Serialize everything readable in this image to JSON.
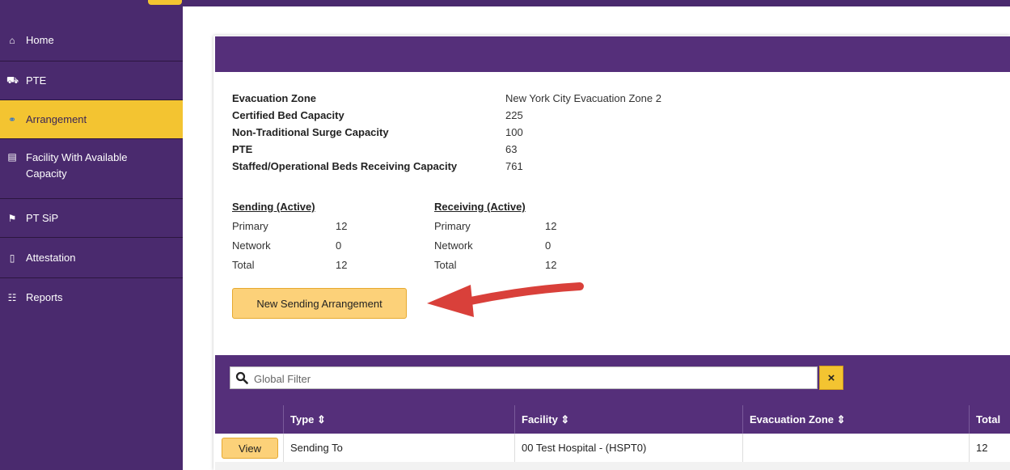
{
  "sidebar": {
    "items": [
      {
        "label": "Home",
        "icon": "home-icon"
      },
      {
        "label": "PTE",
        "icon": "vehicles-icon"
      },
      {
        "label": "Arrangement",
        "icon": "handshake-icon",
        "active": true
      },
      {
        "label": "Facility With Available Capacity",
        "icon": "building-icon"
      },
      {
        "label": "PT SiP",
        "icon": "flag-icon"
      },
      {
        "label": "Attestation",
        "icon": "document-icon"
      },
      {
        "label": "Reports",
        "icon": "users-icon"
      }
    ]
  },
  "info": {
    "rows": [
      {
        "label": "Evacuation Zone",
        "value": "New York City Evacuation Zone 2"
      },
      {
        "label": "Certified Bed Capacity",
        "value": "225"
      },
      {
        "label": "Non-Traditional Surge Capacity",
        "value": "100"
      },
      {
        "label": "PTE",
        "value": "63"
      },
      {
        "label": "Staffed/Operational Beds Receiving Capacity",
        "value": "761"
      }
    ]
  },
  "sending": {
    "title": "Sending (Active)",
    "rows": [
      {
        "label": "Primary",
        "value": "12"
      },
      {
        "label": "Network",
        "value": "0"
      },
      {
        "label": "Total",
        "value": "12"
      }
    ]
  },
  "receiving": {
    "title": "Receiving (Active)",
    "rows": [
      {
        "label": "Primary",
        "value": "12"
      },
      {
        "label": "Network",
        "value": "0"
      },
      {
        "label": "Total",
        "value": "12"
      }
    ]
  },
  "actions": {
    "new_sending": "New Sending Arrangement"
  },
  "filter": {
    "placeholder": "Global Filter",
    "clear_label": "×"
  },
  "table": {
    "columns": [
      "Type ⇕",
      "Facility ⇕",
      "Evacuation Zone ⇕",
      "Total"
    ],
    "rows": [
      {
        "action": "View",
        "type": "Sending To",
        "facility": "00 Test Hospital - (HSPT0)",
        "zone": "",
        "total": "12"
      }
    ]
  },
  "colors": {
    "brand": "#552f7a",
    "accent": "#f3c431",
    "button": "#fcd179",
    "arrow": "#d9403a"
  }
}
